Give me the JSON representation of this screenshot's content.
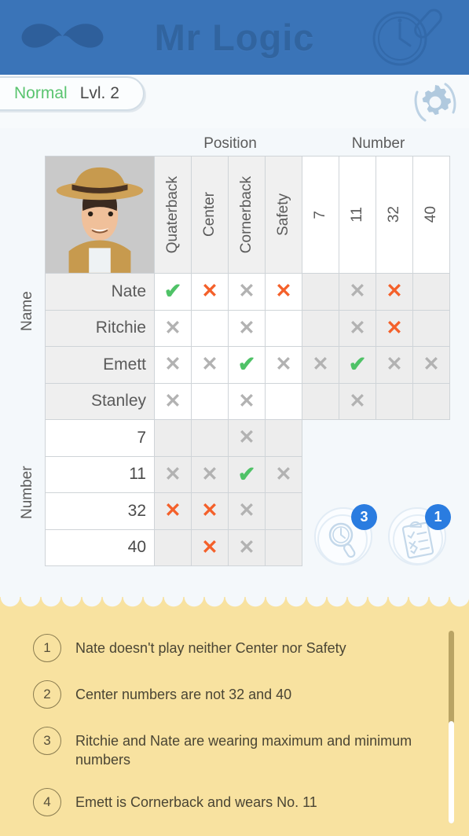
{
  "header": {
    "title": "Mr Logic",
    "mustache_icon": "mustache-icon",
    "magnifier_icon": "magnifier-icon",
    "brand_bg": "#3a74b8",
    "brand_text_color": "#31649f"
  },
  "levelbar": {
    "mode": "Normal",
    "mode_color": "#5ac46f",
    "level": "Lvl. 2",
    "settings_icon": "gear-icon"
  },
  "grid": {
    "top_category_left": "Position",
    "top_category_right": "Number",
    "side_category_top": "Name",
    "side_category_bottom": "Number",
    "avatar_icon": "detective-avatar",
    "col_headers": [
      "Quaterback",
      "Center",
      "Cornerback",
      "Safety",
      "7",
      "11",
      "32",
      "40"
    ],
    "row_headers": [
      "Nate",
      "Ritchie",
      "Emett",
      "Stanley",
      "7",
      "11",
      "32",
      "40"
    ],
    "marks": [
      [
        "check",
        "x-red",
        "x-gray",
        "x-red",
        "",
        "x-gray",
        "x-red",
        ""
      ],
      [
        "x-gray",
        "",
        "x-gray",
        "",
        "",
        "x-gray",
        "x-red",
        ""
      ],
      [
        "x-gray",
        "x-gray",
        "check",
        "x-gray",
        "x-gray",
        "check",
        "x-gray",
        "x-gray"
      ],
      [
        "x-gray",
        "",
        "x-gray",
        "",
        "",
        "x-gray",
        "",
        ""
      ],
      [
        "",
        "",
        "x-gray",
        "",
        null,
        null,
        null,
        null
      ],
      [
        "x-gray",
        "x-gray",
        "check",
        "x-gray",
        null,
        null,
        null,
        null
      ],
      [
        "x-red",
        "x-red",
        "x-gray",
        "",
        null,
        null,
        null,
        null
      ],
      [
        "",
        "x-red",
        "x-gray",
        "",
        null,
        null,
        null,
        null
      ]
    ],
    "glyphs": {
      "check": "✔",
      "x-gray": "✕",
      "x-red": "✕"
    },
    "colors": {
      "check": "#4fc267",
      "x_gray": "#b2b2b2",
      "x_red": "#f4602a"
    }
  },
  "actions": [
    {
      "name": "hint-button",
      "icon": "magnifier-icon",
      "badge": "3"
    },
    {
      "name": "notes-button",
      "icon": "clipboard-icon",
      "badge": "1"
    }
  ],
  "clues": {
    "panel_color": "#f8e2a0",
    "items": [
      {
        "num": "1",
        "text": "Nate doesn't play neither Center nor Safety"
      },
      {
        "num": "2",
        "text": "Center numbers are not 32 and 40"
      },
      {
        "num": "3",
        "text": "Ritchie and Nate are wearing maximum and minimum numbers"
      },
      {
        "num": "4",
        "text": "Emett is Cornerback and wears No. 11"
      }
    ]
  }
}
